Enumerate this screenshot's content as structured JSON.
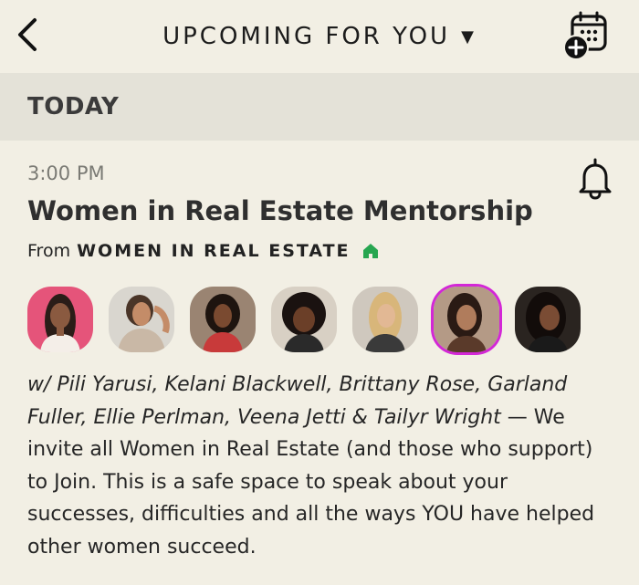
{
  "header": {
    "title": "UPCOMING FOR YOU",
    "caret": "▼",
    "back_icon": "chevron-left-icon",
    "calendar_icon": "calendar-add-icon"
  },
  "section": {
    "title": "TODAY"
  },
  "event": {
    "time": "3:00 PM",
    "title": "Women in Real Estate Mentorship",
    "from_label": "From",
    "club": "WOMEN IN REAL ESTATE",
    "club_icon": "house-icon",
    "bell_icon": "bell-icon",
    "speakers_names": "w/ Pili Yarusi, Kelani Blackwell, Brittany Rose, Garland Fuller, Ellie Perlman, Veena Jetti & Tailyr Wright",
    "description": " — We invite all Women in Real Estate (and those who support) to Join. This is a safe space to speak about your successes, difficulties and all the ways YOU have helped other women succeed."
  },
  "colors": {
    "background": "#f2efe4",
    "section_bar": "#e4e2d8",
    "club_house": "#27a650",
    "speaking_ring": "#d327d6"
  }
}
